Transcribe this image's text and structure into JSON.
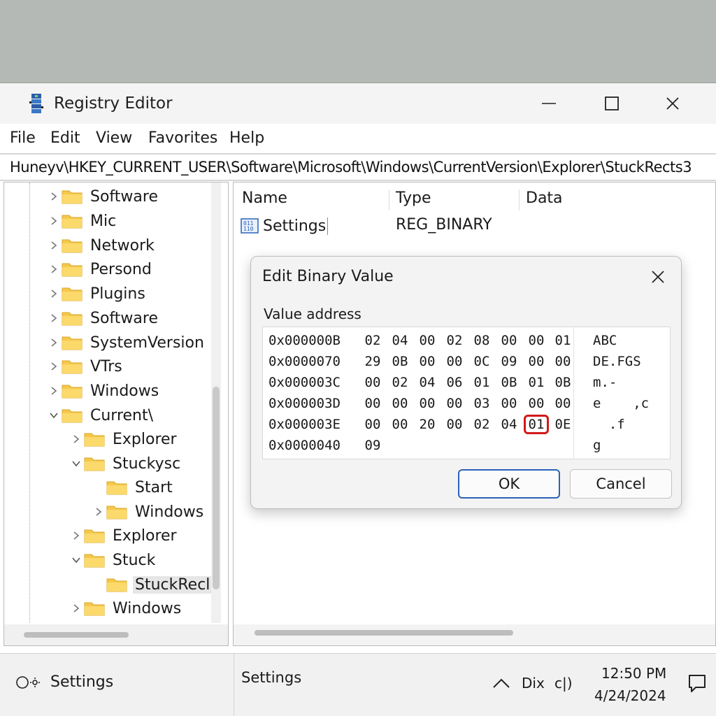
{
  "window": {
    "title": "Registry Editor",
    "controls": {
      "minimize": "minimize",
      "maximize": "maximize",
      "close": "close"
    }
  },
  "menu": [
    "File",
    "Edit",
    "View",
    "Favorites",
    "Help"
  ],
  "address": "Huneyv\\HKEY_CURRENT_USER\\Software\\Microsoft\\Windows\\CurrentVersion\\Explorer\\StuckRects3",
  "tree": [
    {
      "label": "Software",
      "expander": "collapsed"
    },
    {
      "label": "Mic",
      "expander": "collapsed"
    },
    {
      "label": "Network",
      "expander": "collapsed"
    },
    {
      "label": "Persond",
      "expander": "collapsed"
    },
    {
      "label": "Plugins",
      "expander": "collapsed"
    },
    {
      "label": "Software",
      "expander": "collapsed"
    },
    {
      "label": "SystemVersion",
      "expander": "collapsed"
    },
    {
      "label": "VTrs",
      "expander": "collapsed"
    },
    {
      "label": "Windows",
      "expander": "collapsed"
    },
    {
      "label": "Current\\",
      "expander": "expanded"
    },
    {
      "label": "Explorer",
      "expander": "collapsed"
    },
    {
      "label": "Stuckysc",
      "expander": "expanded"
    },
    {
      "label": "Start",
      "expander": "none"
    },
    {
      "label": "Windows",
      "expander": "collapsed"
    },
    {
      "label": "Explorer",
      "expander": "collapsed"
    },
    {
      "label": "Stuck",
      "expander": "expanded"
    },
    {
      "label": "StuckRecl",
      "expander": "none",
      "selected": true
    },
    {
      "label": "Windows",
      "expander": "collapsed"
    }
  ],
  "list": {
    "columns": {
      "name": "Name",
      "type": "Type",
      "data": "Data"
    },
    "rows": [
      {
        "name": "Settings",
        "type": "REG_BINARY",
        "icon": "binary-value-icon"
      }
    ]
  },
  "dialog": {
    "title": "Edit Binary Value",
    "label": "Value address",
    "rows": [
      {
        "address": "0x000000B",
        "bytes": [
          "02",
          "04",
          "00",
          "02",
          "08",
          "00",
          "00",
          "01"
        ],
        "ascii": "ABC"
      },
      {
        "address": "0x0000070",
        "bytes": [
          "29",
          "0B",
          "00",
          "00",
          "0C",
          "09",
          "00",
          "00"
        ],
        "ascii": "DE.FGS"
      },
      {
        "address": "0x000003C",
        "bytes": [
          "00",
          "02",
          "04",
          "06",
          "01",
          "0B",
          "01",
          "0B"
        ],
        "ascii": "m.-"
      },
      {
        "address": "0x000003D",
        "bytes": [
          "00",
          "00",
          "00",
          "00",
          "03",
          "00",
          "00",
          "00"
        ],
        "ascii": "e    ,c"
      },
      {
        "address": "0x000003E",
        "bytes": [
          "00",
          "00",
          "20",
          "00",
          "02",
          "04",
          "01",
          "0E"
        ],
        "ascii": "  .f"
      },
      {
        "address": "0x0000040",
        "bytes": [
          "09"
        ],
        "ascii": "g"
      }
    ],
    "highlighted_byte": {
      "row": 4,
      "col": 6,
      "color": "#d11a1a"
    },
    "ok_label": "OK",
    "cancel_label": "Cancel"
  },
  "taskbar": {
    "left_label": "Settings",
    "center_label": "Settings",
    "lang": "Dix",
    "volume": "c|)",
    "time": "12:50 PM",
    "date": "4/24/2024"
  },
  "colors": {
    "accent": "#2a63b8",
    "folder": "#f5c84b",
    "highlight": "#d11a1a"
  }
}
